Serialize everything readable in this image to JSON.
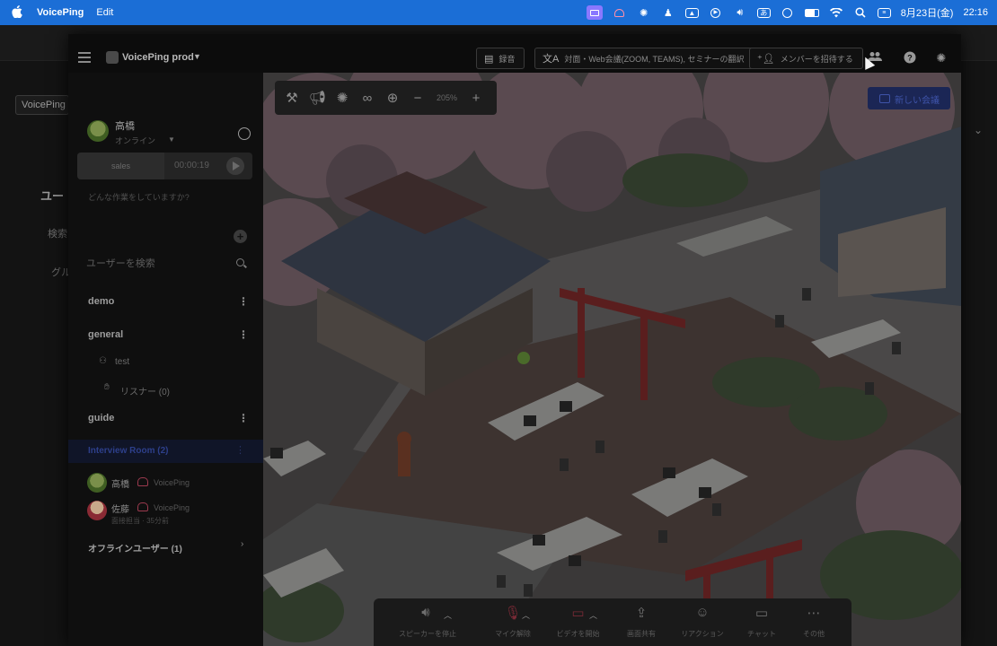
{
  "menubar": {
    "app_name": "VoicePing",
    "menu_items": [
      "Edit"
    ],
    "status_icons": [
      "screen-share-icon",
      "voiceping-icon",
      "gear-icon",
      "figure-icon",
      "upload-icon",
      "play-circle-icon",
      "volume-icon",
      "input-method-icon",
      "user-circle-icon",
      "battery-icon",
      "wifi-icon",
      "spotlight-search-icon",
      "control-center-icon"
    ],
    "input_method": "あ",
    "date": "8月23日(金)",
    "time": "22:16"
  },
  "background_window": {
    "dropdown_label": "VoicePing",
    "heading": "ユー",
    "text1": "検索",
    "text2": "グル"
  },
  "workspace": {
    "name": "VoicePing prod"
  },
  "header_buttons": {
    "record": "録音",
    "translate": "対面・Web会議(ZOOM, TEAMS), セミナーの翻訳",
    "invite": "メンバーを招待する"
  },
  "user": {
    "name": "高橋",
    "status": "オンライン"
  },
  "task": {
    "label": "sales",
    "elapsed": "00:00:19",
    "prompt": "どんな作業をしていますか?"
  },
  "search": {
    "placeholder": "ユーザーを検索"
  },
  "sections": {
    "demo": "demo",
    "general": "general",
    "general_sub1": "test",
    "general_sub2": "リスナー (0)",
    "guide": "guide",
    "active_room": "Interview Room (2)",
    "offline": "オフラインユーザー (1)"
  },
  "members": [
    {
      "name": "高橋",
      "org": "VoicePing",
      "note": ""
    },
    {
      "name": "佐藤",
      "org": "VoicePing",
      "note": "面接担当 · 35分前"
    }
  ],
  "map": {
    "zoom": "205%",
    "new_meeting": "新しい会議"
  },
  "bottom_bar": {
    "speaker": "スピーカーを停止",
    "mic": "マイク解除",
    "video": "ビデオを開始",
    "share": "画面共有",
    "reaction": "リアクション",
    "chat": "チャット",
    "more": "その他"
  },
  "colors": {
    "menubar_bg": "#1b6ed6",
    "accent_blue": "#3e53a8",
    "muted_red": "#7a2a36"
  }
}
